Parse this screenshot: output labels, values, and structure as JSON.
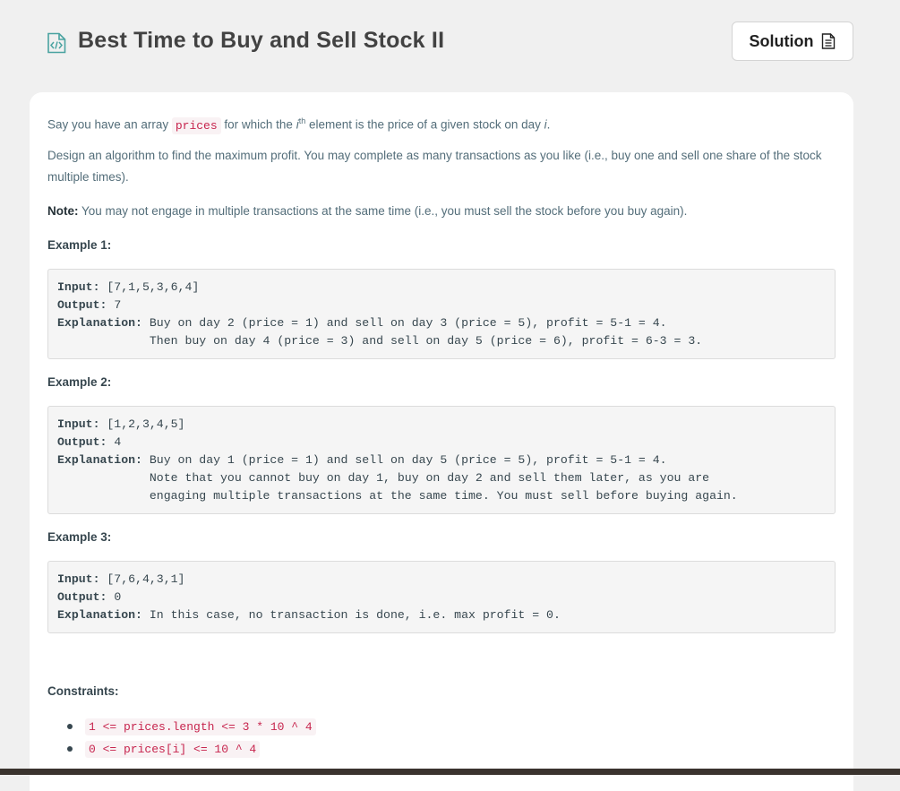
{
  "header": {
    "title": "Best Time to Buy and Sell Stock II",
    "title_icon": "code-file-icon",
    "solution_label": "Solution",
    "solution_icon": "document-icon",
    "accent_color": "#4aa3a1"
  },
  "description": {
    "p1_before": "Say you have an array ",
    "p1_code": "prices",
    "p1_mid": " for which the ",
    "p1_i": "i",
    "p1_sup": "th",
    "p1_after": " element is the price of a given stock on day ",
    "p1_day": "i",
    "p1_end": ".",
    "p2": "Design an algorithm to find the maximum profit. You may complete as many transactions as you like (i.e., buy one and sell one share of the stock multiple times).",
    "note_label": "Note:",
    "note_text": " You may not engage in multiple transactions at the same time (i.e., you must sell the stock before you buy again)."
  },
  "examples": [
    {
      "title": "Example 1:",
      "input_label": "Input:",
      "input": " [7,1,5,3,6,4]",
      "output_label": "Output:",
      "output": " 7",
      "explanation_label": "Explanation:",
      "explanation": " Buy on day 2 (price = 1) and sell on day 3 (price = 5), profit = 5-1 = 4.\n             Then buy on day 4 (price = 3) and sell on day 5 (price = 6), profit = 6-3 = 3."
    },
    {
      "title": "Example 2:",
      "input_label": "Input:",
      "input": " [1,2,3,4,5]",
      "output_label": "Output:",
      "output": " 4",
      "explanation_label": "Explanation:",
      "explanation": " Buy on day 1 (price = 1) and sell on day 5 (price = 5), profit = 5-1 = 4.\n             Note that you cannot buy on day 1, buy on day 2 and sell them later, as you are\n             engaging multiple transactions at the same time. You must sell before buying again."
    },
    {
      "title": "Example 3:",
      "input_label": "Input:",
      "input": " [7,6,4,3,1]",
      "output_label": "Output:",
      "output": " 0",
      "explanation_label": "Explanation:",
      "explanation": " In this case, no transaction is done, i.e. max profit = 0."
    }
  ],
  "constraints": {
    "title": "Constraints:",
    "items": [
      "1 <= prices.length <= 3 * 10 ^ 4",
      "0 <= prices[i] <= 10 ^ 4"
    ]
  }
}
